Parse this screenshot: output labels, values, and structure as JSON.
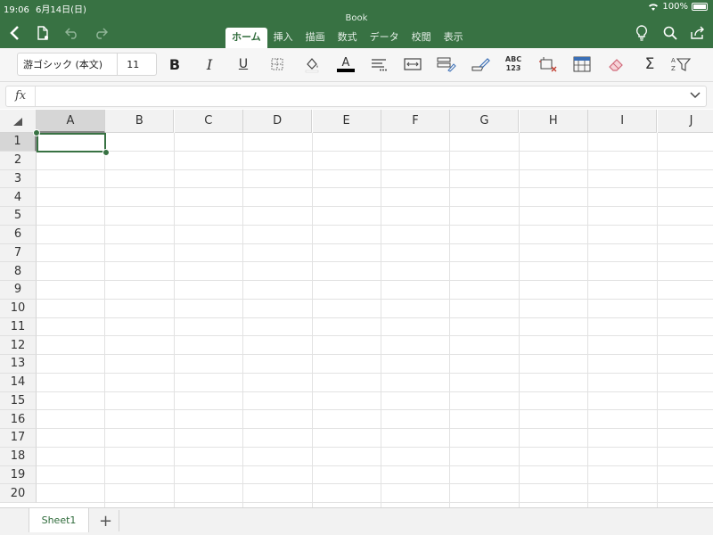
{
  "status": {
    "time": "19:06",
    "date": "6月14日(日)",
    "battery": "100%"
  },
  "document": {
    "title": "Book"
  },
  "tabs": [
    {
      "label": "ホーム",
      "active": true
    },
    {
      "label": "挿入",
      "active": false
    },
    {
      "label": "描画",
      "active": false
    },
    {
      "label": "数式",
      "active": false
    },
    {
      "label": "データ",
      "active": false
    },
    {
      "label": "校閲",
      "active": false
    },
    {
      "label": "表示",
      "active": false
    }
  ],
  "ribbon": {
    "font_name": "游ゴシック (本文)",
    "font_size": "11",
    "bold": "B",
    "italic": "I",
    "underline": "U",
    "spell_check_top": "ABC",
    "spell_check_bottom": "123",
    "autosum": "Σ",
    "sort_a": "A",
    "sort_z": "Z"
  },
  "formula_bar": {
    "fx_label": "fx",
    "value": ""
  },
  "grid": {
    "columns": [
      "A",
      "B",
      "C",
      "D",
      "E",
      "F",
      "G",
      "H",
      "I",
      "J"
    ],
    "rows": [
      "1",
      "2",
      "3",
      "4",
      "5",
      "6",
      "7",
      "8",
      "9",
      "10",
      "11",
      "12",
      "13",
      "14",
      "15",
      "16",
      "17",
      "18",
      "19",
      "20"
    ],
    "selected_cell": "A1"
  },
  "sheets": {
    "tabs": [
      "Sheet1"
    ],
    "add_label": "+"
  },
  "colors": {
    "accent": "#387243",
    "header_bg": "#387243"
  }
}
